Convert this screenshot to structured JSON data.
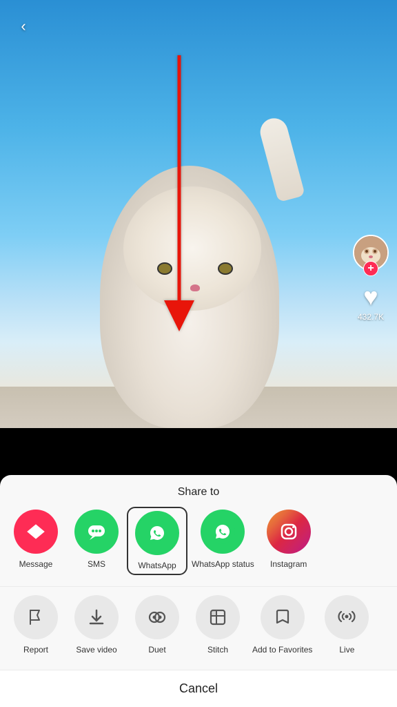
{
  "header": {
    "back_label": "‹"
  },
  "video": {
    "like_count": "432.7K"
  },
  "avatar": {
    "plus_label": "+"
  },
  "sheet": {
    "title": "Share to",
    "share_items": [
      {
        "id": "message",
        "label": "Message",
        "icon": "✈",
        "color_class": "icon-message"
      },
      {
        "id": "sms",
        "label": "SMS",
        "icon": "💬",
        "color_class": "icon-sms"
      },
      {
        "id": "whatsapp",
        "label": "WhatsApp",
        "icon": "📱",
        "color_class": "icon-whatsapp"
      },
      {
        "id": "whatsapp-status",
        "label": "WhatsApp status",
        "icon": "📱",
        "color_class": "icon-whatsapp-status"
      },
      {
        "id": "instagram",
        "label": "Instagram",
        "icon": "📷",
        "color_class": "icon-instagram"
      }
    ],
    "action_items": [
      {
        "id": "report",
        "label": "Report",
        "icon": "⚑"
      },
      {
        "id": "save-video",
        "label": "Save video",
        "icon": "⬇"
      },
      {
        "id": "duet",
        "label": "Duet",
        "icon": "◎"
      },
      {
        "id": "stitch",
        "label": "Stitch",
        "icon": "⊞"
      },
      {
        "id": "add-favorites",
        "label": "Add to Favorites",
        "icon": "🔖"
      },
      {
        "id": "live",
        "label": "Live",
        "icon": "📡"
      }
    ],
    "cancel_label": "Cancel"
  }
}
